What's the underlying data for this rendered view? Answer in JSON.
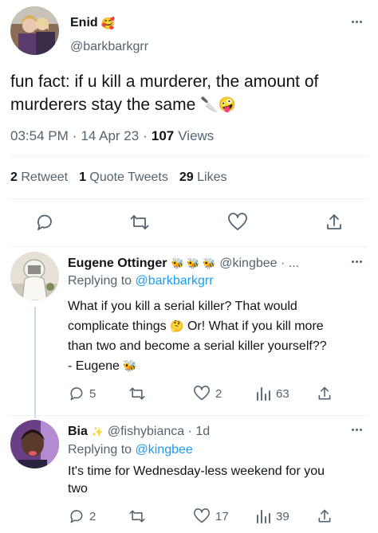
{
  "main_tweet": {
    "display_name": "Enid",
    "name_emoji": "🥰",
    "handle": "@barkbarkgrr",
    "text_line1": "fun fact: if u kill a murderer, the amount of",
    "text_line2": "murderers stay the same",
    "text_emojis": "🔪🤪",
    "time": "03:54 PM",
    "date": "14 Apr 23",
    "views_count": "107",
    "views_label": "Views",
    "retweets_count": "2",
    "retweets_label": "Retweet",
    "quotes_count": "1",
    "quotes_label": "Quote Tweets",
    "likes_count": "29",
    "likes_label": "Likes"
  },
  "replies": [
    {
      "display_name": "Eugene Ottinger",
      "name_emojis": "🐝 🐝 🐝",
      "handle": "@kingbee · ...",
      "replying_prefix": "Replying to",
      "replying_to": "@barkbarkgrr",
      "line1": "What if you kill a serial killer? That would",
      "line2a": "complicate things",
      "line2_emoji": "🤔",
      "line2b": "Or! What if you kill more",
      "line3": "than two and become a serial killer yourself??",
      "line4": "- Eugene",
      "line4_emoji": "🐝",
      "replies": "5",
      "retweets": "",
      "likes": "2",
      "views": "63"
    },
    {
      "display_name": "Bia",
      "name_emoji": "✨",
      "handle": "@fishybianca · 1d",
      "replying_prefix": "Replying to",
      "replying_to": "@kingbee",
      "line1": "It's time for Wednesday-less weekend for you",
      "line2": "two",
      "replies": "2",
      "retweets": "",
      "likes": "17",
      "views": "39"
    }
  ],
  "colors": {
    "accent": "#1d9bf0",
    "muted": "#536471",
    "text": "#0f1419",
    "divider": "#eff3f4"
  },
  "icons": [
    "more-icon",
    "reply-icon",
    "retweet-icon",
    "like-icon",
    "share-icon",
    "views-icon"
  ]
}
